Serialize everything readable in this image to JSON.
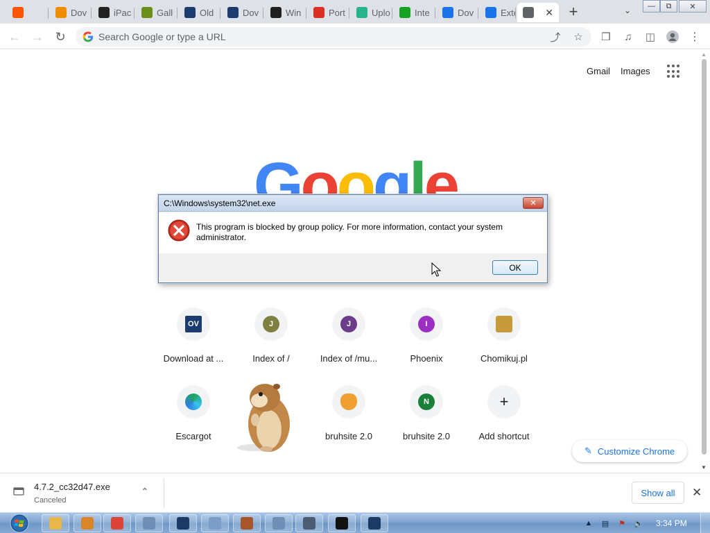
{
  "tabs": [
    {
      "label": "",
      "icon": "soundcloud-icon",
      "color": "#ff5500"
    },
    {
      "label": "Dov",
      "icon": "avast-icon",
      "color": "#f08c00"
    },
    {
      "label": "iPac",
      "icon": "ipac-icon",
      "color": "#222222"
    },
    {
      "label": "Gall",
      "icon": "gallery-icon",
      "color": "#6a8f1d"
    },
    {
      "label": "Old",
      "icon": "oldversion-icon",
      "color": "#1c3b6e"
    },
    {
      "label": "Dov",
      "icon": "oldversion-icon",
      "color": "#1c3b6e"
    },
    {
      "label": "Win",
      "icon": "winworld-icon",
      "color": "#1f1f1f"
    },
    {
      "label": "Port",
      "icon": "portable-icon",
      "color": "#d93025"
    },
    {
      "label": "Uplo",
      "icon": "upload-icon",
      "color": "#26b48a"
    },
    {
      "label": "Inte",
      "icon": "play-icon",
      "color": "#14a322"
    },
    {
      "label": "Dov",
      "icon": "download-icon",
      "color": "#1a73e8"
    },
    {
      "label": "Exte",
      "icon": "puzzle-icon",
      "color": "#1a73e8"
    },
    {
      "label": "",
      "icon": "chrome-icon",
      "color": "#5f6368",
      "active": true
    }
  ],
  "toolbar": {
    "omnibox_placeholder": "Search Google or type a URL"
  },
  "ntp": {
    "gmail": "Gmail",
    "images": "Images",
    "logo_letters": [
      {
        "ch": "G",
        "color": "#4285f4"
      },
      {
        "ch": "o",
        "color": "#ea4335"
      },
      {
        "ch": "o",
        "color": "#fbbc05"
      },
      {
        "ch": "g",
        "color": "#4285f4"
      },
      {
        "ch": "l",
        "color": "#34a853"
      },
      {
        "ch": "e",
        "color": "#ea4335"
      }
    ],
    "shortcuts": [
      {
        "label": "Download at ...",
        "badge": "OV",
        "color": "#1c3b6e",
        "kind": "square"
      },
      {
        "label": "Index of /",
        "badge": "J",
        "color": "#7f7f3f",
        "kind": "letter"
      },
      {
        "label": "Index of /mu...",
        "badge": "J",
        "color": "#6c3b8c",
        "kind": "letter"
      },
      {
        "label": "Phoenix",
        "badge": "I",
        "color": "#9b2fc2",
        "kind": "letter"
      },
      {
        "label": "Chomikuj.pl",
        "badge": "",
        "color": "#c79a3a",
        "kind": "image"
      },
      {
        "label": "Escargot",
        "badge": "",
        "color": "#1fa45a",
        "kind": "edge"
      },
      {
        "label": "",
        "badge": "",
        "color": "#ffffff",
        "kind": "hidden"
      },
      {
        "label": "bruhsite 2.0",
        "badge": "",
        "color": "#f0a030",
        "kind": "cat"
      },
      {
        "label": "bruhsite 2.0",
        "badge": "N",
        "color": "#188038",
        "kind": "letter"
      },
      {
        "label": "Add shortcut",
        "badge": "+",
        "color": "#202124",
        "kind": "add"
      }
    ],
    "customize": "Customize Chrome"
  },
  "dialog": {
    "title": "C:\\Windows\\system32\\net.exe",
    "message": "This program is blocked by group policy. For more information, contact your system administrator.",
    "ok": "OK"
  },
  "download": {
    "filename": "4.7.2_cc32d47.exe",
    "status": "Canceled",
    "show_all": "Show all"
  },
  "taskbar": {
    "clock": "3:34 PM",
    "items": [
      {
        "icon": "explorer-icon",
        "color": "#e8b84a"
      },
      {
        "icon": "media-player-icon",
        "color": "#d9862a"
      },
      {
        "icon": "chrome-icon",
        "color": "#db4437"
      },
      {
        "icon": "window-icon",
        "color": "#6f8fb7"
      },
      {
        "icon": "triangle-app-icon",
        "color": "#1b3a64"
      },
      {
        "icon": "notepad-icon",
        "color": "#7a9ec8"
      },
      {
        "icon": "paint-icon",
        "color": "#a8552b"
      },
      {
        "icon": "window-icon",
        "color": "#6f8fb7"
      },
      {
        "icon": "cross-stitch-icon",
        "color": "#4c5d73"
      },
      {
        "icon": "7zip-icon",
        "color": "#111111"
      },
      {
        "icon": "triangle-app-icon",
        "color": "#1b3a64"
      }
    ]
  }
}
